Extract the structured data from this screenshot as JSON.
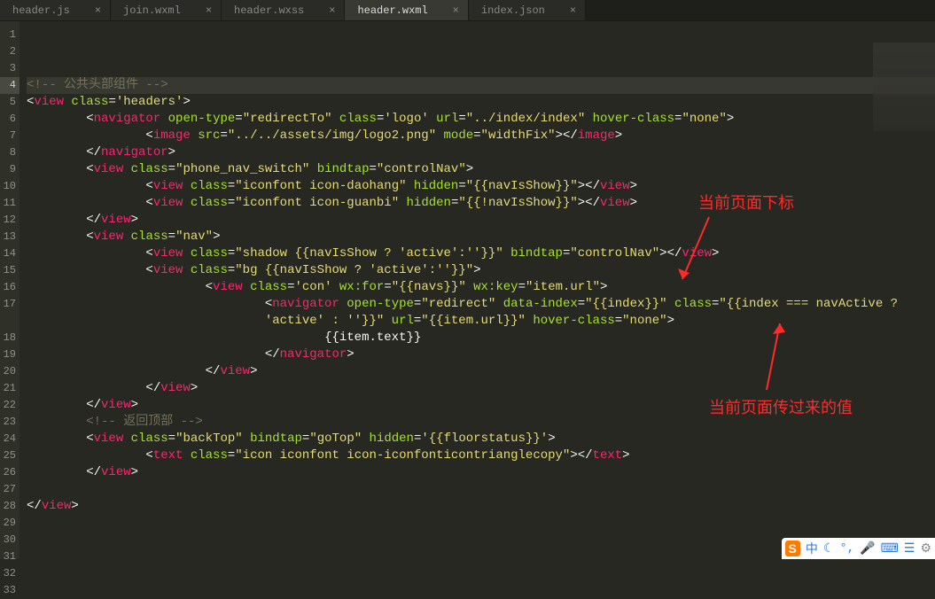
{
  "tabs": [
    {
      "label": "header.js",
      "active": false
    },
    {
      "label": "join.wxml",
      "active": false
    },
    {
      "label": "header.wxss",
      "active": false
    },
    {
      "label": "header.wxml",
      "active": true
    },
    {
      "label": "index.json",
      "active": false
    }
  ],
  "close_glyph": "×",
  "line_numbers": [
    "1",
    "2",
    "3",
    "4",
    "5",
    "6",
    "7",
    "8",
    "9",
    "10",
    "11",
    "12",
    "13",
    "14",
    "15",
    "16",
    "17",
    "",
    "18",
    "19",
    "20",
    "21",
    "22",
    "23",
    "24",
    "25",
    "26",
    "27",
    "28",
    "29",
    "30",
    "31",
    "32",
    "33"
  ],
  "current_line_index": 3,
  "code_lines": [
    {
      "t": "blank"
    },
    {
      "t": "blank"
    },
    {
      "t": "blank"
    },
    {
      "t": "comment",
      "indent": 0,
      "text": "<!-- 公共头部组件 -->"
    },
    {
      "t": "open",
      "indent": 0,
      "tag": "view",
      "attrs": [
        [
          "class",
          "'headers'"
        ]
      ]
    },
    {
      "t": "open",
      "indent": 2,
      "tag": "navigator",
      "attrs": [
        [
          "open-type",
          "\"redirectTo\""
        ],
        [
          "class",
          "'logo'"
        ],
        [
          "url",
          "\"../index/index\""
        ],
        [
          "hover-class",
          "\"none\""
        ]
      ]
    },
    {
      "t": "selfpair",
      "indent": 4,
      "tag": "image",
      "attrs": [
        [
          "src",
          "\"../../assets/img/logo2.png\""
        ],
        [
          "mode",
          "\"widthFix\""
        ]
      ]
    },
    {
      "t": "close",
      "indent": 2,
      "tag": "navigator"
    },
    {
      "t": "open",
      "indent": 2,
      "tag": "view",
      "attrs": [
        [
          "class",
          "\"phone_nav_switch\""
        ],
        [
          "bindtap",
          "\"controlNav\""
        ]
      ]
    },
    {
      "t": "selfpair",
      "indent": 4,
      "tag": "view",
      "attrs": [
        [
          "class",
          "\"iconfont icon-daohang\""
        ],
        [
          "hidden",
          "\"{{navIsShow}}\""
        ]
      ]
    },
    {
      "t": "selfpair",
      "indent": 4,
      "tag": "view",
      "attrs": [
        [
          "class",
          "\"iconfont icon-guanbi\""
        ],
        [
          "hidden",
          "\"{{!navIsShow}}\""
        ]
      ]
    },
    {
      "t": "close",
      "indent": 2,
      "tag": "view"
    },
    {
      "t": "open",
      "indent": 2,
      "tag": "view",
      "attrs": [
        [
          "class",
          "\"nav\""
        ]
      ]
    },
    {
      "t": "selfpair",
      "indent": 4,
      "tag": "view",
      "attrs": [
        [
          "class",
          "\"shadow {{navIsShow ? 'active':''}}\""
        ],
        [
          "bindtap",
          "\"controlNav\""
        ]
      ]
    },
    {
      "t": "open",
      "indent": 4,
      "tag": "view",
      "attrs": [
        [
          "class",
          "\"bg {{navIsShow ? 'active':''}}\""
        ]
      ]
    },
    {
      "t": "open",
      "indent": 6,
      "tag": "view",
      "attrs": [
        [
          "class",
          "'con'"
        ],
        [
          "wx:for",
          "\"{{navs}}\""
        ],
        [
          "wx:key",
          "\"item.url\""
        ]
      ]
    },
    {
      "t": "nav2open",
      "indent": 8
    },
    {
      "t": "nav2cont",
      "indent": 8
    },
    {
      "t": "text",
      "indent": 10,
      "text": "{{item.text}}"
    },
    {
      "t": "close",
      "indent": 8,
      "tag": "navigator"
    },
    {
      "t": "close",
      "indent": 6,
      "tag": "view"
    },
    {
      "t": "close",
      "indent": 4,
      "tag": "view"
    },
    {
      "t": "close",
      "indent": 2,
      "tag": "view"
    },
    {
      "t": "comment",
      "indent": 2,
      "text": "<!-- 返回顶部 -->"
    },
    {
      "t": "open",
      "indent": 2,
      "tag": "view",
      "attrs": [
        [
          "class",
          "\"backTop\""
        ],
        [
          "bindtap",
          "\"goTop\""
        ],
        [
          "hidden",
          "'{{floorstatus}}'"
        ]
      ]
    },
    {
      "t": "selfpair",
      "indent": 4,
      "tag": "text",
      "attrs": [
        [
          "class",
          "\"icon iconfont icon-iconfonticontrianglecopy\""
        ]
      ]
    },
    {
      "t": "close",
      "indent": 2,
      "tag": "view"
    },
    {
      "t": "blank"
    },
    {
      "t": "close",
      "indent": 0,
      "tag": "view"
    },
    {
      "t": "blank"
    },
    {
      "t": "blank"
    },
    {
      "t": "blank"
    },
    {
      "t": "blank"
    }
  ],
  "nav2": {
    "tag": "navigator",
    "open_type": "\"redirect\"",
    "data_index": "\"{{index}}\"",
    "class": "\"{{index === navActive ? ",
    "cont": "'active' : ''}}\"",
    "url": "\"{{item.url}}\"",
    "hover": "\"none\""
  },
  "annotations": {
    "top": "当前页面下标",
    "bottom": "当前页面传过来的值"
  },
  "ime": {
    "logo_glyph": "S",
    "items": [
      "中",
      "☾",
      "°,",
      "🎤",
      "⌨",
      "☰",
      "⚙"
    ]
  }
}
